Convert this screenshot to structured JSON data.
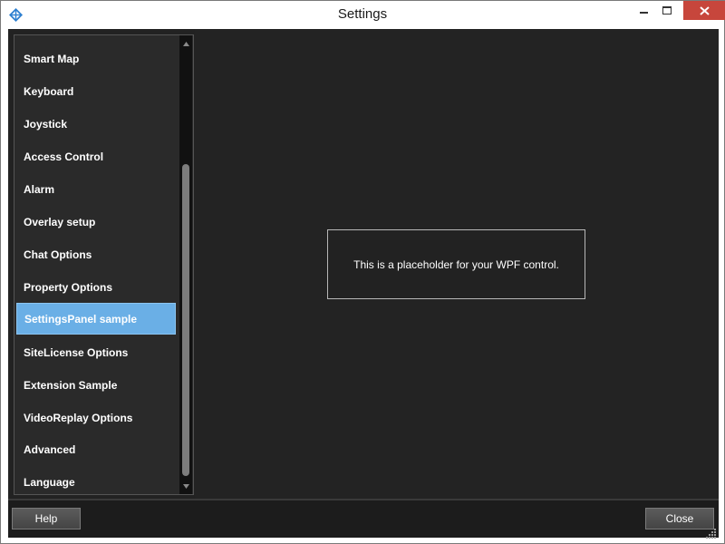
{
  "window": {
    "title": "Settings",
    "app_icon": "diamond-crosshair-icon",
    "controls": [
      "minimize-icon",
      "maximize-icon",
      "close-icon"
    ]
  },
  "sidebar": {
    "items": [
      {
        "label": "Smart Map"
      },
      {
        "label": "Keyboard"
      },
      {
        "label": "Joystick"
      },
      {
        "label": "Access Control"
      },
      {
        "label": "Alarm"
      },
      {
        "label": "Overlay setup"
      },
      {
        "label": "Chat Options"
      },
      {
        "label": "Property Options"
      },
      {
        "label": "SettingsPanel sample",
        "selected": true
      },
      {
        "label": "SiteLicense Options"
      },
      {
        "label": "Extension Sample"
      },
      {
        "label": "VideoReplay Options"
      },
      {
        "label": "Advanced"
      },
      {
        "label": "Language"
      }
    ],
    "selected_index": 8
  },
  "content": {
    "placeholder_text": "This is a placeholder for your WPF control."
  },
  "footer": {
    "help_label": "Help",
    "close_label": "Close"
  },
  "colors": {
    "background": "#222222",
    "selected_item": "#6aafe6",
    "close_button": "#c7463c"
  }
}
